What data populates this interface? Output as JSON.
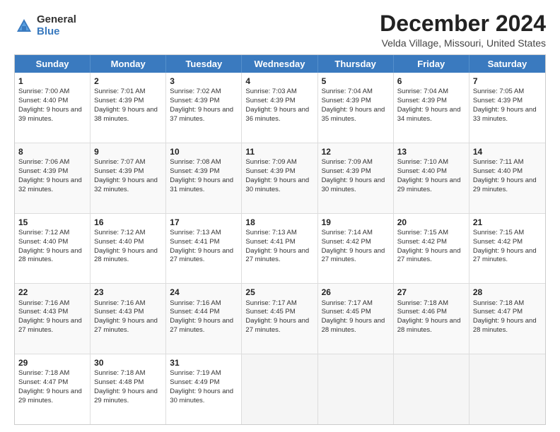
{
  "logo": {
    "general": "General",
    "blue": "Blue"
  },
  "title": "December 2024",
  "location": "Velda Village, Missouri, United States",
  "header_days": [
    "Sunday",
    "Monday",
    "Tuesday",
    "Wednesday",
    "Thursday",
    "Friday",
    "Saturday"
  ],
  "rows": [
    [
      {
        "day": "1",
        "sunrise": "Sunrise: 7:00 AM",
        "sunset": "Sunset: 4:40 PM",
        "daylight": "Daylight: 9 hours and 39 minutes."
      },
      {
        "day": "2",
        "sunrise": "Sunrise: 7:01 AM",
        "sunset": "Sunset: 4:39 PM",
        "daylight": "Daylight: 9 hours and 38 minutes."
      },
      {
        "day": "3",
        "sunrise": "Sunrise: 7:02 AM",
        "sunset": "Sunset: 4:39 PM",
        "daylight": "Daylight: 9 hours and 37 minutes."
      },
      {
        "day": "4",
        "sunrise": "Sunrise: 7:03 AM",
        "sunset": "Sunset: 4:39 PM",
        "daylight": "Daylight: 9 hours and 36 minutes."
      },
      {
        "day": "5",
        "sunrise": "Sunrise: 7:04 AM",
        "sunset": "Sunset: 4:39 PM",
        "daylight": "Daylight: 9 hours and 35 minutes."
      },
      {
        "day": "6",
        "sunrise": "Sunrise: 7:04 AM",
        "sunset": "Sunset: 4:39 PM",
        "daylight": "Daylight: 9 hours and 34 minutes."
      },
      {
        "day": "7",
        "sunrise": "Sunrise: 7:05 AM",
        "sunset": "Sunset: 4:39 PM",
        "daylight": "Daylight: 9 hours and 33 minutes."
      }
    ],
    [
      {
        "day": "8",
        "sunrise": "Sunrise: 7:06 AM",
        "sunset": "Sunset: 4:39 PM",
        "daylight": "Daylight: 9 hours and 32 minutes."
      },
      {
        "day": "9",
        "sunrise": "Sunrise: 7:07 AM",
        "sunset": "Sunset: 4:39 PM",
        "daylight": "Daylight: 9 hours and 32 minutes."
      },
      {
        "day": "10",
        "sunrise": "Sunrise: 7:08 AM",
        "sunset": "Sunset: 4:39 PM",
        "daylight": "Daylight: 9 hours and 31 minutes."
      },
      {
        "day": "11",
        "sunrise": "Sunrise: 7:09 AM",
        "sunset": "Sunset: 4:39 PM",
        "daylight": "Daylight: 9 hours and 30 minutes."
      },
      {
        "day": "12",
        "sunrise": "Sunrise: 7:09 AM",
        "sunset": "Sunset: 4:39 PM",
        "daylight": "Daylight: 9 hours and 30 minutes."
      },
      {
        "day": "13",
        "sunrise": "Sunrise: 7:10 AM",
        "sunset": "Sunset: 4:40 PM",
        "daylight": "Daylight: 9 hours and 29 minutes."
      },
      {
        "day": "14",
        "sunrise": "Sunrise: 7:11 AM",
        "sunset": "Sunset: 4:40 PM",
        "daylight": "Daylight: 9 hours and 29 minutes."
      }
    ],
    [
      {
        "day": "15",
        "sunrise": "Sunrise: 7:12 AM",
        "sunset": "Sunset: 4:40 PM",
        "daylight": "Daylight: 9 hours and 28 minutes."
      },
      {
        "day": "16",
        "sunrise": "Sunrise: 7:12 AM",
        "sunset": "Sunset: 4:40 PM",
        "daylight": "Daylight: 9 hours and 28 minutes."
      },
      {
        "day": "17",
        "sunrise": "Sunrise: 7:13 AM",
        "sunset": "Sunset: 4:41 PM",
        "daylight": "Daylight: 9 hours and 27 minutes."
      },
      {
        "day": "18",
        "sunrise": "Sunrise: 7:13 AM",
        "sunset": "Sunset: 4:41 PM",
        "daylight": "Daylight: 9 hours and 27 minutes."
      },
      {
        "day": "19",
        "sunrise": "Sunrise: 7:14 AM",
        "sunset": "Sunset: 4:42 PM",
        "daylight": "Daylight: 9 hours and 27 minutes."
      },
      {
        "day": "20",
        "sunrise": "Sunrise: 7:15 AM",
        "sunset": "Sunset: 4:42 PM",
        "daylight": "Daylight: 9 hours and 27 minutes."
      },
      {
        "day": "21",
        "sunrise": "Sunrise: 7:15 AM",
        "sunset": "Sunset: 4:42 PM",
        "daylight": "Daylight: 9 hours and 27 minutes."
      }
    ],
    [
      {
        "day": "22",
        "sunrise": "Sunrise: 7:16 AM",
        "sunset": "Sunset: 4:43 PM",
        "daylight": "Daylight: 9 hours and 27 minutes."
      },
      {
        "day": "23",
        "sunrise": "Sunrise: 7:16 AM",
        "sunset": "Sunset: 4:43 PM",
        "daylight": "Daylight: 9 hours and 27 minutes."
      },
      {
        "day": "24",
        "sunrise": "Sunrise: 7:16 AM",
        "sunset": "Sunset: 4:44 PM",
        "daylight": "Daylight: 9 hours and 27 minutes."
      },
      {
        "day": "25",
        "sunrise": "Sunrise: 7:17 AM",
        "sunset": "Sunset: 4:45 PM",
        "daylight": "Daylight: 9 hours and 27 minutes."
      },
      {
        "day": "26",
        "sunrise": "Sunrise: 7:17 AM",
        "sunset": "Sunset: 4:45 PM",
        "daylight": "Daylight: 9 hours and 28 minutes."
      },
      {
        "day": "27",
        "sunrise": "Sunrise: 7:18 AM",
        "sunset": "Sunset: 4:46 PM",
        "daylight": "Daylight: 9 hours and 28 minutes."
      },
      {
        "day": "28",
        "sunrise": "Sunrise: 7:18 AM",
        "sunset": "Sunset: 4:47 PM",
        "daylight": "Daylight: 9 hours and 28 minutes."
      }
    ],
    [
      {
        "day": "29",
        "sunrise": "Sunrise: 7:18 AM",
        "sunset": "Sunset: 4:47 PM",
        "daylight": "Daylight: 9 hours and 29 minutes."
      },
      {
        "day": "30",
        "sunrise": "Sunrise: 7:18 AM",
        "sunset": "Sunset: 4:48 PM",
        "daylight": "Daylight: 9 hours and 29 minutes."
      },
      {
        "day": "31",
        "sunrise": "Sunrise: 7:19 AM",
        "sunset": "Sunset: 4:49 PM",
        "daylight": "Daylight: 9 hours and 30 minutes."
      },
      null,
      null,
      null,
      null
    ]
  ]
}
